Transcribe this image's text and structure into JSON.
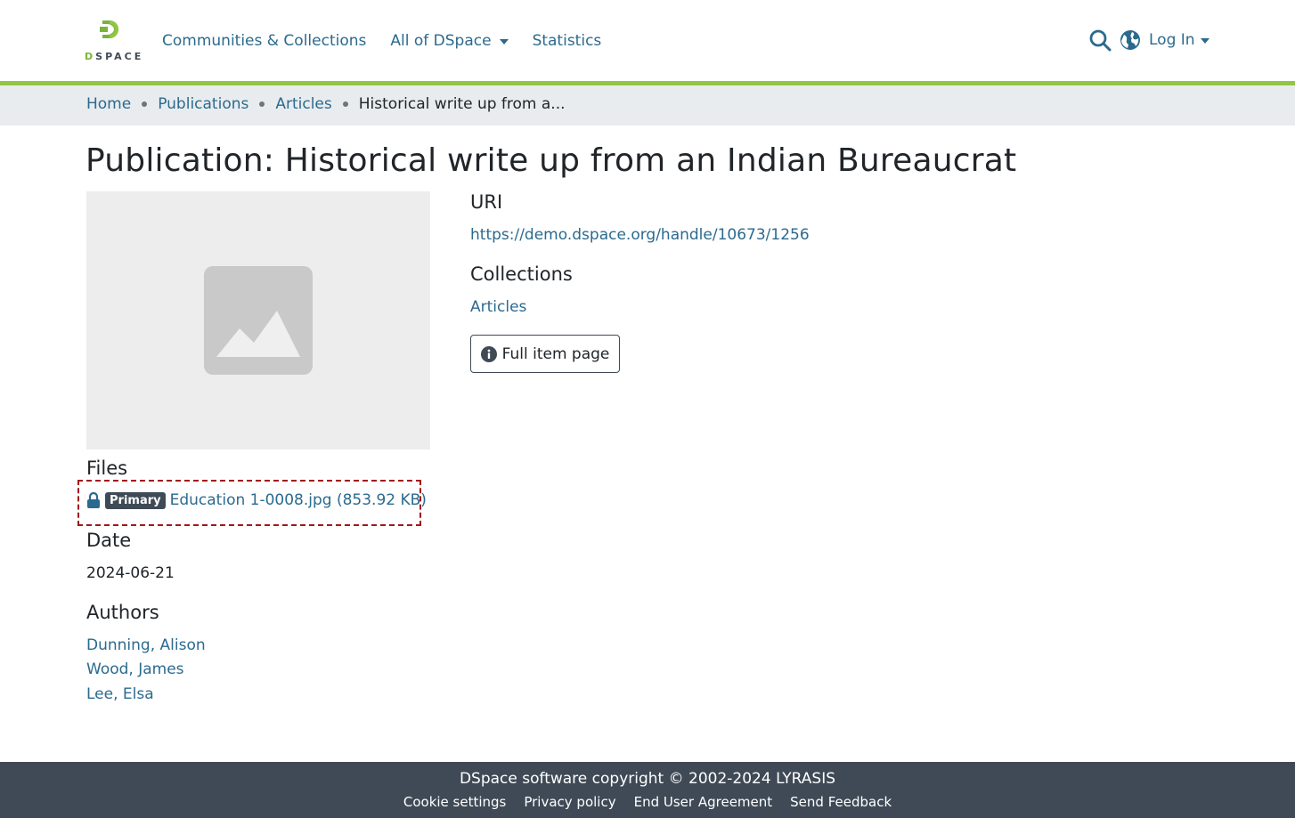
{
  "header": {
    "logo_text": "SPACE",
    "logo_letter": "D",
    "nav": {
      "communities": "Communities & Collections",
      "all_of_dspace": "All of DSpace",
      "statistics": "Statistics"
    },
    "login": "Log In"
  },
  "breadcrumb": {
    "home": "Home",
    "publications": "Publications",
    "articles": "Articles",
    "current": "Historical write up from a..."
  },
  "page": {
    "title": "Publication: Historical write up from an Indian Bureaucrat"
  },
  "files": {
    "heading": "Files",
    "badge": "Primary",
    "file_link": "Education 1-0008.jpg (853.92 KB)"
  },
  "date": {
    "heading": "Date",
    "value": "2024-06-21"
  },
  "authors": {
    "heading": "Authors",
    "list": [
      "Dunning, Alison",
      "Wood, James",
      "Lee, Elsa"
    ]
  },
  "uri": {
    "heading": "URI",
    "value": "https://demo.dspace.org/handle/10673/1256"
  },
  "collections": {
    "heading": "Collections",
    "value": "Articles"
  },
  "full_item_button": "Full item page",
  "footer": {
    "copyright": "DSpace software copyright © 2002-2024 LYRASIS",
    "links": [
      "Cookie settings",
      "Privacy policy",
      "End User Agreement",
      "Send Feedback"
    ]
  },
  "colors": {
    "link": "#2b6a8e",
    "accent_green": "#92c642",
    "footer_bg": "#3f4a56",
    "highlight_border": "#a31515"
  }
}
